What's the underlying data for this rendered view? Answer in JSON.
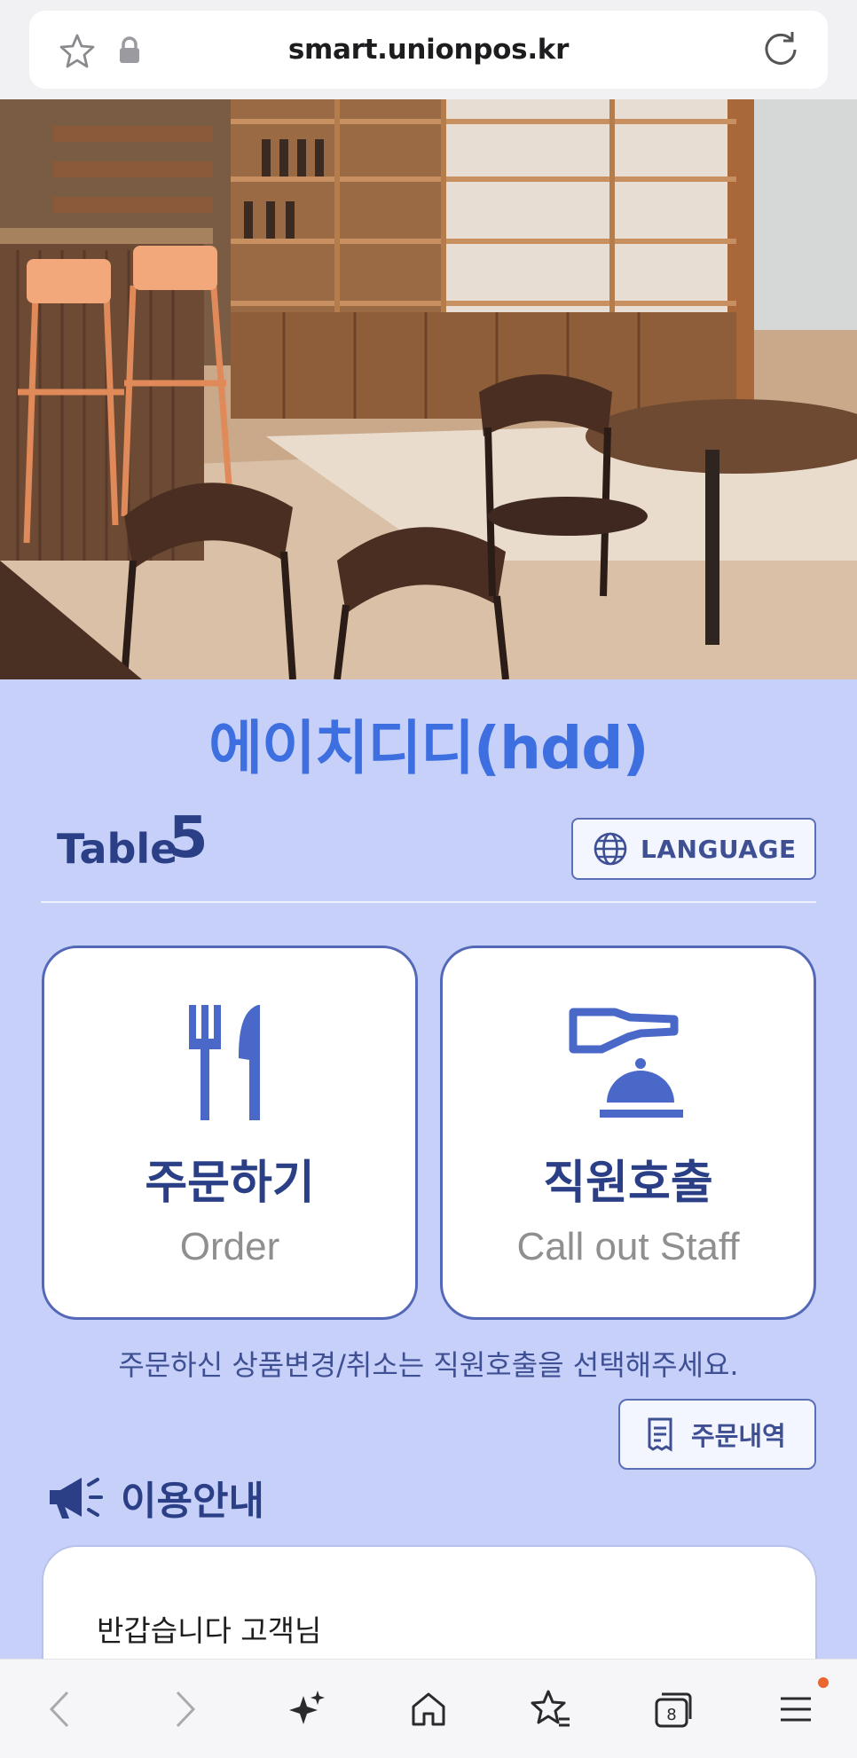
{
  "browser": {
    "url": "smart.unionpos.kr",
    "tabs_count": "8"
  },
  "store": {
    "name": "에이치디디(hdd)"
  },
  "table": {
    "label": "Table",
    "number": "5"
  },
  "language_button": {
    "label": "LANGUAGE"
  },
  "cards": {
    "order": {
      "title": "주문하기",
      "subtitle": "Order"
    },
    "staff": {
      "title": "직원호출",
      "subtitle": "Call out Staff"
    }
  },
  "notice": "주문하신 상품변경/취소는 직원호출을 선택해주세요.",
  "order_history_button": {
    "label": "주문내역"
  },
  "guide": {
    "heading": "이용안내",
    "text": "반갑습니다 고객님"
  },
  "colors": {
    "background": "#c7d0f8",
    "accent": "#3d6fe0",
    "primary_text": "#2b3f86",
    "icon": "#4a68c8"
  }
}
